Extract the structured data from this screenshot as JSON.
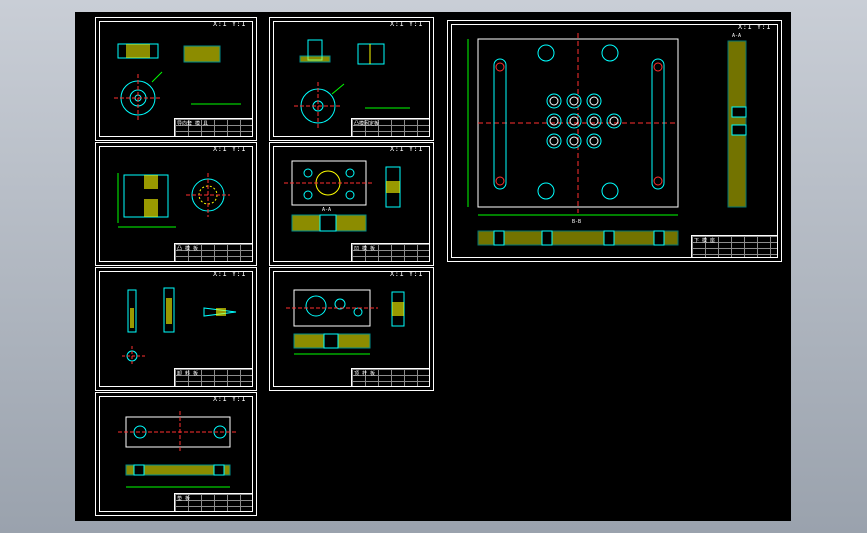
{
  "scale_note": "X:1 Y:1",
  "sheets": [
    {
      "name": "sheet-1",
      "title": "导向套 模 具"
    },
    {
      "name": "sheet-2",
      "title": "凸模固定板"
    },
    {
      "name": "sheet-3",
      "title": "凸 模 板"
    },
    {
      "name": "sheet-4",
      "title": "凹 模 板"
    },
    {
      "name": "sheet-5",
      "title": "卸 料 板"
    },
    {
      "name": "sheet-6",
      "title": "顶 杆 板"
    },
    {
      "name": "sheet-7",
      "title": "垫 板"
    },
    {
      "name": "sheet-8",
      "title": "下 模 座"
    }
  ],
  "view_labels": {
    "section_aa": "A-A",
    "section_bb": "B-B"
  },
  "colors": {
    "outline": "#00ffff",
    "hatch": "#ffff00",
    "center": "#ff3030",
    "dim": "#00ff00",
    "frame": "#ffffff"
  }
}
